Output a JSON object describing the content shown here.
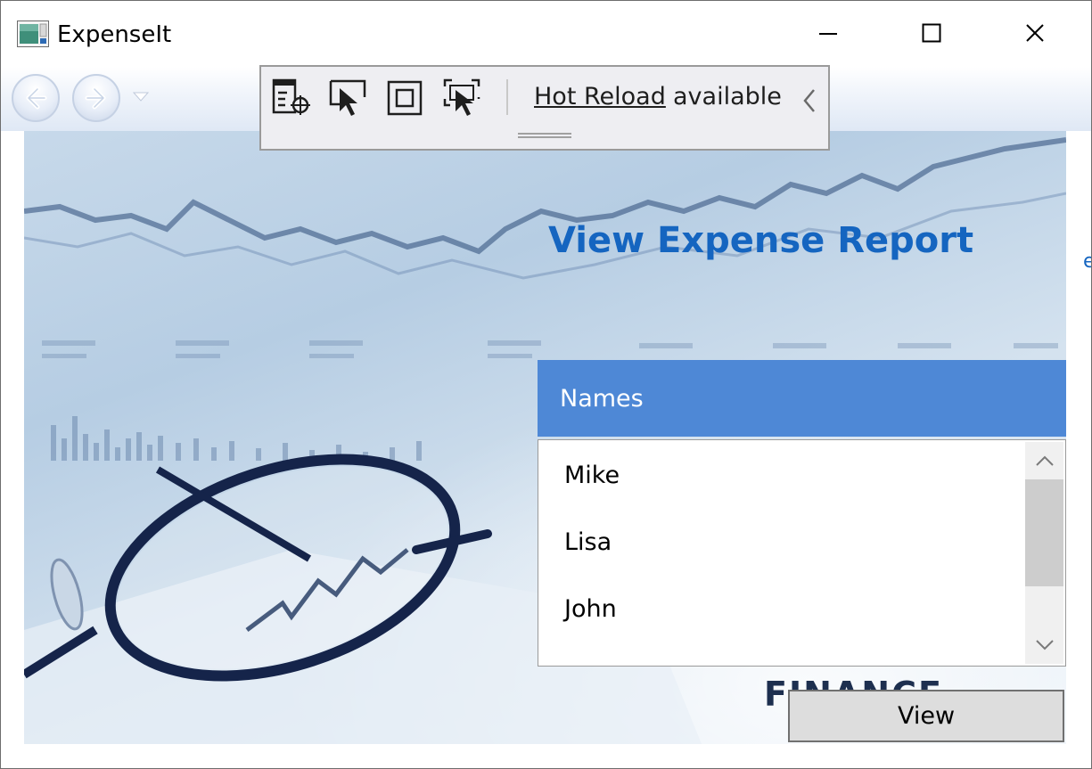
{
  "window": {
    "title": "ExpenseIt"
  },
  "toolbar": {
    "hot_reload_link": "Hot Reload",
    "hot_reload_suffix": "available"
  },
  "page": {
    "heading": "View Expense Report",
    "names_header": "Names",
    "names": [
      "Mike",
      "Lisa",
      "John"
    ],
    "background_text": "FINANCE",
    "view_button": "View"
  },
  "icons": {
    "app": "app-icon",
    "minimize": "minimize-icon",
    "maximize": "maximize-icon",
    "close": "close-icon",
    "back": "back-arrow-icon",
    "forward": "forward-arrow-icon",
    "history": "chevron-down-icon",
    "toolbar": [
      "live-visual-tree-icon",
      "select-element-icon",
      "display-layout-adorners-icon",
      "track-focused-element-icon",
      "collapse-chevron-icon"
    ],
    "scroll": [
      "scroll-up-icon",
      "scroll-down-icon"
    ]
  },
  "colors": {
    "heading": "#1565c0",
    "names_header_bg": "#4e88d6",
    "button_bg": "#dddddd",
    "toolbar_bg": "#eeeef2",
    "scroll_thumb": "#cdcdcd"
  }
}
